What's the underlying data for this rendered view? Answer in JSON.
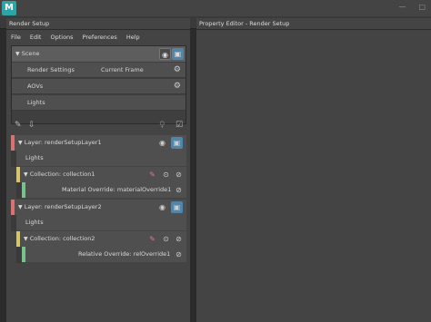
{
  "window": {
    "app_icon_letter": "M",
    "minimize_glyph": "—",
    "maximize_glyph": "▢"
  },
  "tabs": {
    "render_setup": "Render Setup",
    "property_editor": "Property Editor - Render Setup"
  },
  "menu": [
    "File",
    "Edit",
    "Options",
    "Preferences",
    "Help"
  ],
  "scene": {
    "header": "Scene",
    "render_settings": "Render Settings",
    "current_frame": "Current Frame",
    "aovs": "AOVs",
    "lights": "Lights"
  },
  "layers": [
    {
      "label": "Layer:",
      "name": "renderSetupLayer1",
      "lights": "Lights",
      "collection_label": "Collection:",
      "collection_name": "collection1",
      "override_label": "Material Override:",
      "override_name": "materialOverride1"
    },
    {
      "label": "Layer:",
      "name": "renderSetupLayer2",
      "lights": "Lights",
      "collection_label": "Collection:",
      "collection_name": "collection2",
      "override_label": "Relative Override:",
      "override_name": "relOverride1"
    }
  ],
  "icons": {
    "scene_collapse": "chevron-down-icon",
    "visibility": "eye-icon",
    "renderable": "render-icon",
    "settings": "gear-icon",
    "create_layer": "add-layer-icon",
    "import": "import-icon",
    "lightbulb": "lightbulb-icon",
    "checklist": "checklist-icon",
    "disable": "disable-icon",
    "isolate": "isolate-icon",
    "material": "material-icon"
  },
  "colors": {
    "layer_stripe": "#d97272",
    "collection_stripe": "#d6c56a",
    "override_stripe": "#79c28b",
    "render_active": "#5285a6"
  }
}
